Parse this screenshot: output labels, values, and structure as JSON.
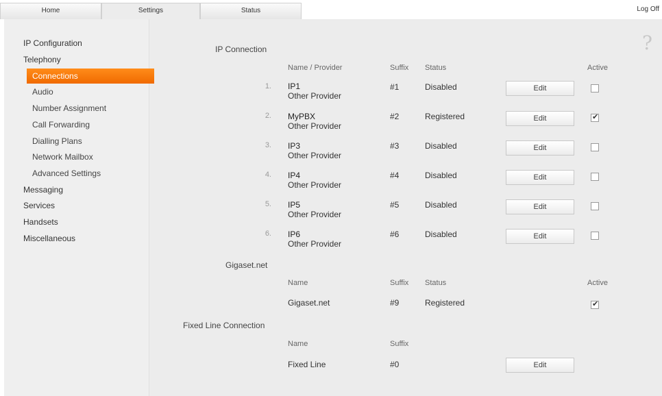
{
  "tabs": {
    "home": "Home",
    "settings": "Settings",
    "status": "Status"
  },
  "logoff": "Log Off",
  "sidebar": {
    "items": [
      "IP Configuration",
      "Telephony",
      "Messaging",
      "Services",
      "Handsets",
      "Miscellaneous"
    ],
    "telephony_sub": [
      "Connections",
      "Audio",
      "Number Assignment",
      "Call Forwarding",
      "Dialling Plans",
      "Network Mailbox",
      "Advanced Settings"
    ],
    "active": "Connections"
  },
  "help_icon": "help-icon",
  "ip_connection": {
    "title": "IP Connection",
    "headers": {
      "name": "Name / Provider",
      "suffix": "Suffix",
      "status": "Status",
      "active": "Active"
    },
    "edit_label": "Edit",
    "rows": [
      {
        "num": "1.",
        "name": "IP1",
        "provider": "Other Provider",
        "suffix": "#1",
        "status": "Disabled",
        "active": false
      },
      {
        "num": "2.",
        "name": "MyPBX",
        "provider": "Other Provider",
        "suffix": "#2",
        "status": "Registered",
        "active": true
      },
      {
        "num": "3.",
        "name": "IP3",
        "provider": "Other Provider",
        "suffix": "#3",
        "status": "Disabled",
        "active": false
      },
      {
        "num": "4.",
        "name": "IP4",
        "provider": "Other Provider",
        "suffix": "#4",
        "status": "Disabled",
        "active": false
      },
      {
        "num": "5.",
        "name": "IP5",
        "provider": "Other Provider",
        "suffix": "#5",
        "status": "Disabled",
        "active": false
      },
      {
        "num": "6.",
        "name": "IP6",
        "provider": "Other Provider",
        "suffix": "#6",
        "status": "Disabled",
        "active": false
      }
    ]
  },
  "gigaset": {
    "title": "Gigaset.net",
    "headers": {
      "name": "Name",
      "suffix": "Suffix",
      "status": "Status",
      "active": "Active"
    },
    "row": {
      "name": "Gigaset.net",
      "suffix": "#9",
      "status": "Registered",
      "active": true
    }
  },
  "fixed_line": {
    "title": "Fixed Line Connection",
    "headers": {
      "name": "Name",
      "suffix": "Suffix"
    },
    "row": {
      "name": "Fixed Line",
      "suffix": "#0"
    },
    "edit_label": "Edit"
  }
}
